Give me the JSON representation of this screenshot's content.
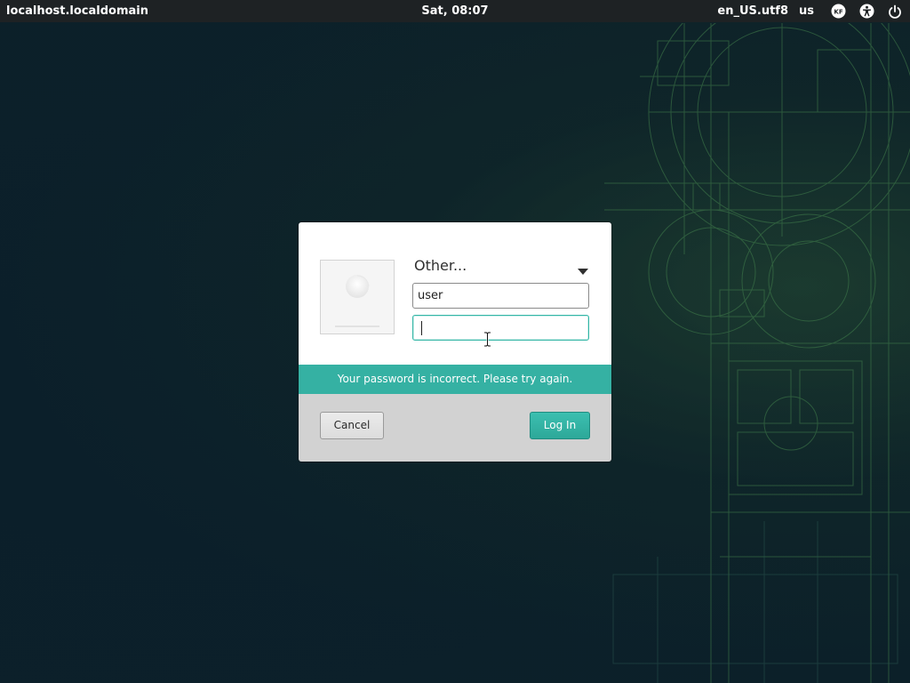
{
  "topbar": {
    "hostname": "localhost.localdomain",
    "clock": "Sat, 08:07",
    "locale": "en_US.utf8",
    "keyboard_layout": "us",
    "icons": [
      "input-method-icon",
      "accessibility-icon",
      "power-icon"
    ]
  },
  "dialog": {
    "user_select": {
      "selected": "Other...",
      "icon": "chevron-down-icon"
    },
    "username_field": {
      "value": "user"
    },
    "password_field": {
      "value": ""
    },
    "error_message": "Your password is incorrect. Please try again.",
    "cancel_label": "Cancel",
    "login_label": "Log In"
  },
  "colors": {
    "accent": "#35b1a3",
    "topbar": "#1e2224",
    "background": "#0c2029",
    "footer": "#d2d2d2"
  }
}
